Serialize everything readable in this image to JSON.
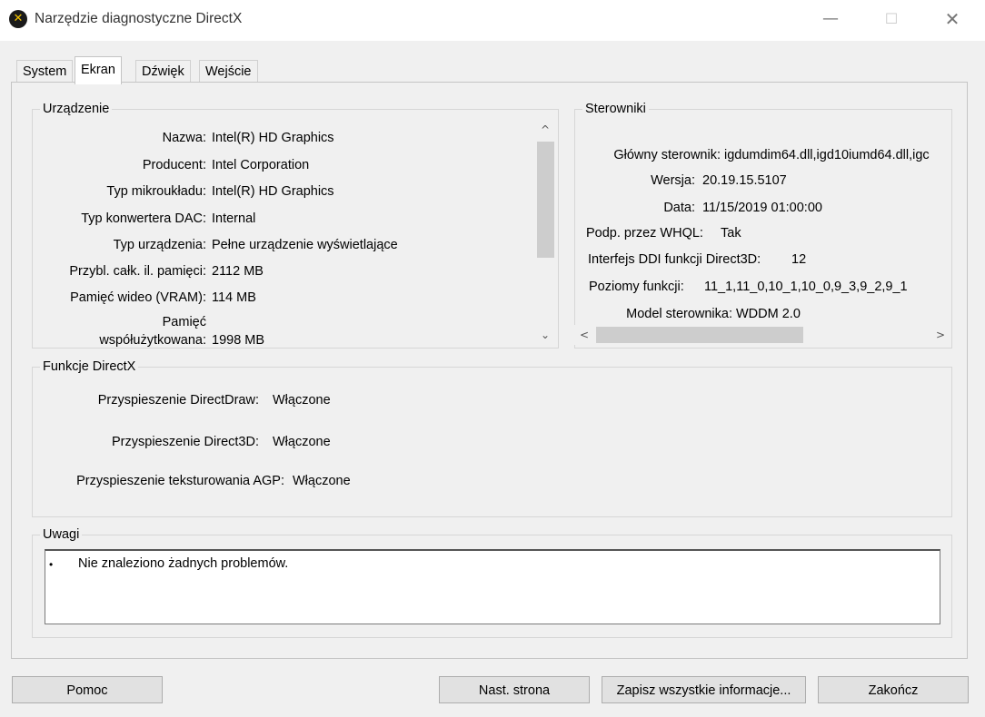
{
  "window": {
    "title": "Narzędzie diagnostyczne DirectX"
  },
  "tabs": [
    {
      "label": "System"
    },
    {
      "label": "Ekran"
    },
    {
      "label": "Dźwięk"
    },
    {
      "label": "Wejście"
    }
  ],
  "device": {
    "title": "Urządzenie",
    "rows": [
      {
        "label": "Nazwa:",
        "value": "Intel(R) HD Graphics"
      },
      {
        "label": "Producent:",
        "value": "Intel Corporation"
      },
      {
        "label": "Typ mikroukładu:",
        "value": "Intel(R) HD Graphics"
      },
      {
        "label": "Typ konwertera DAC:",
        "value": "Internal"
      },
      {
        "label": "Typ urządzenia:",
        "value": "Pełne urządzenie wyświetlające"
      },
      {
        "label": "Przybl. całk. il. pamięci:",
        "value": "2112 MB"
      },
      {
        "label": "Pamięć wideo (VRAM):",
        "value": "114 MB"
      },
      {
        "label_line1": "Pamięć",
        "label_line2": "współużytkowana:",
        "value": "1998 MB"
      }
    ]
  },
  "drivers": {
    "title": "Sterowniki",
    "rows": [
      {
        "label": "Główny sterownik:",
        "value": "igdumdim64.dll,igd10iumd64.dll,igc"
      },
      {
        "label": "Wersja:",
        "value": "20.19.15.5107"
      },
      {
        "label": "Data:",
        "value": "11/15/2019 01:00:00"
      },
      {
        "label": "Podp. przez WHQL:",
        "value": "Tak"
      },
      {
        "label": "Interfejs DDI funkcji Direct3D:",
        "value": "12"
      },
      {
        "label": "Poziomy funkcji:",
        "value": "11_1,11_0,10_1,10_0,9_3,9_2,9_1"
      },
      {
        "label": "Model sterownika:",
        "value": "WDDM 2.0"
      }
    ]
  },
  "features": {
    "title": "Funkcje DirectX",
    "rows": [
      {
        "label": "Przyspieszenie DirectDraw:",
        "value": "Włączone"
      },
      {
        "label": "Przyspieszenie Direct3D:",
        "value": "Włączone"
      },
      {
        "label": "Przyspieszenie teksturowania AGP:",
        "value": "Włączone"
      }
    ]
  },
  "notes": {
    "title": "Uwagi",
    "bullet": "•",
    "text": "Nie znaleziono żadnych problemów."
  },
  "buttons": {
    "help": "Pomoc",
    "next": "Nast. strona",
    "save_all": "Zapisz wszystkie informacje...",
    "exit": "Zakończ"
  },
  "icons": {
    "app": "directx-icon",
    "minimize": "minimize-icon",
    "maximize": "maximize-icon",
    "close": "close-icon",
    "scroll_up": "chevron-up-icon",
    "scroll_down": "chevron-down-icon",
    "scroll_left": "chevron-left-icon",
    "scroll_right": "chevron-right-icon"
  }
}
